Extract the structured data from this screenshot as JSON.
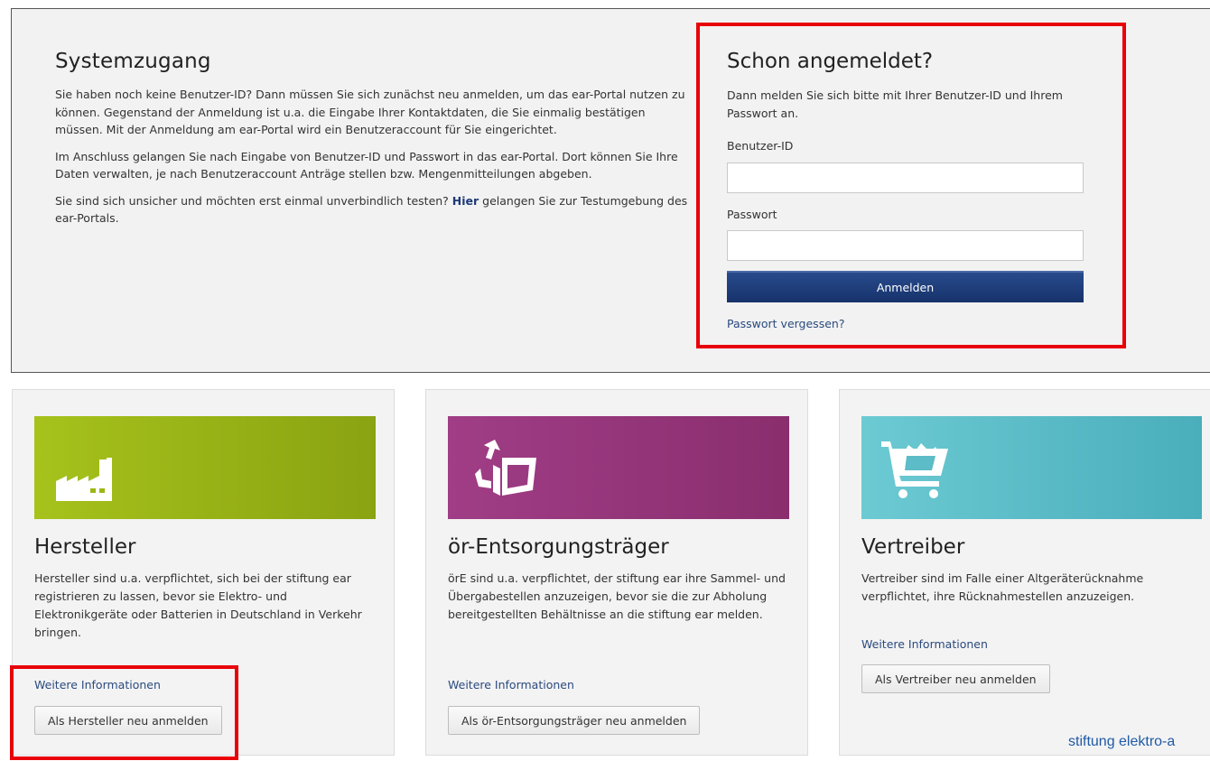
{
  "systemzugang": {
    "title": "Systemzugang",
    "paragraph1": "Sie haben noch keine Benutzer-ID? Dann müssen Sie sich zunächst neu anmelden, um das ear-Portal nutzen zu können. Gegenstand der Anmeldung ist u.a. die Eingabe Ihrer Kontaktdaten, die Sie einmalig bestätigen müssen. Mit der Anmeldung am ear-Portal wird ein Benutzeraccount für Sie eingerichtet.",
    "paragraph2": "Im Anschluss gelangen Sie nach Eingabe von Benutzer-ID und Passwort in das ear-Portal. Dort können Sie Ihre Daten verwalten, je nach Benutzeraccount Anträge stellen bzw. Mengenmitteilungen abgeben.",
    "paragraph3_before": "Sie sind sich unsicher und möchten erst einmal unverbindlich testen? ",
    "paragraph3_link": "Hier",
    "paragraph3_after": " gelangen Sie zur Testumgebung des ear-Portals."
  },
  "login": {
    "title": "Schon angemeldet?",
    "description": "Dann melden Sie sich bitte mit Ihrer Benutzer-ID und Ihrem Passwort an.",
    "userid_label": "Benutzer-ID",
    "userid_value": "",
    "password_label": "Passwort",
    "password_value": "",
    "submit_label": "Anmelden",
    "forgot_label": "Passwort vergessen?"
  },
  "cards": [
    {
      "title": "Hersteller",
      "text": "Hersteller sind u.a. verpflichtet, sich bei der stiftung ear registrieren zu lassen, bevor sie Elektro- und Elektronikgeräte oder Batterien in Deutschland in Verkehr bringen.",
      "link": "Weitere Informationen",
      "button": "Als Hersteller neu anmelden",
      "icon": "factory-icon",
      "color_start": "#a6c21b",
      "color_end": "#8aa312"
    },
    {
      "title": "ör-Entsorgungsträger",
      "text": "örE sind u.a. verpflichtet, der stiftung ear ihre Sammel- und Übergabestellen anzuzeigen, bevor sie die zur Abholung bereitgestellten Behältnisse an die stiftung ear melden.",
      "link": "Weitere Informationen",
      "button": "Als ör-Entsorgungsträger neu anmelden",
      "icon": "recycling-container-icon",
      "color_start": "#a03d86",
      "color_end": "#8a2e6e"
    },
    {
      "title": "Vertreiber",
      "text": "Vertreiber sind im Falle einer Altgeräterücknahme verpflichtet, ihre Rücknahmestellen anzuzeigen.",
      "link": "Weitere Informationen",
      "button": "Als Vertreiber neu anmelden",
      "icon": "shopping-cart-icon",
      "color_start": "#6ccad3",
      "color_end": "#4aaebb"
    }
  ],
  "footer": {
    "text": "stiftung elektro-a"
  },
  "colors": {
    "highlight": "#e8000a",
    "primary_button": "#1e3e7b",
    "link": "#2a4a7f"
  }
}
